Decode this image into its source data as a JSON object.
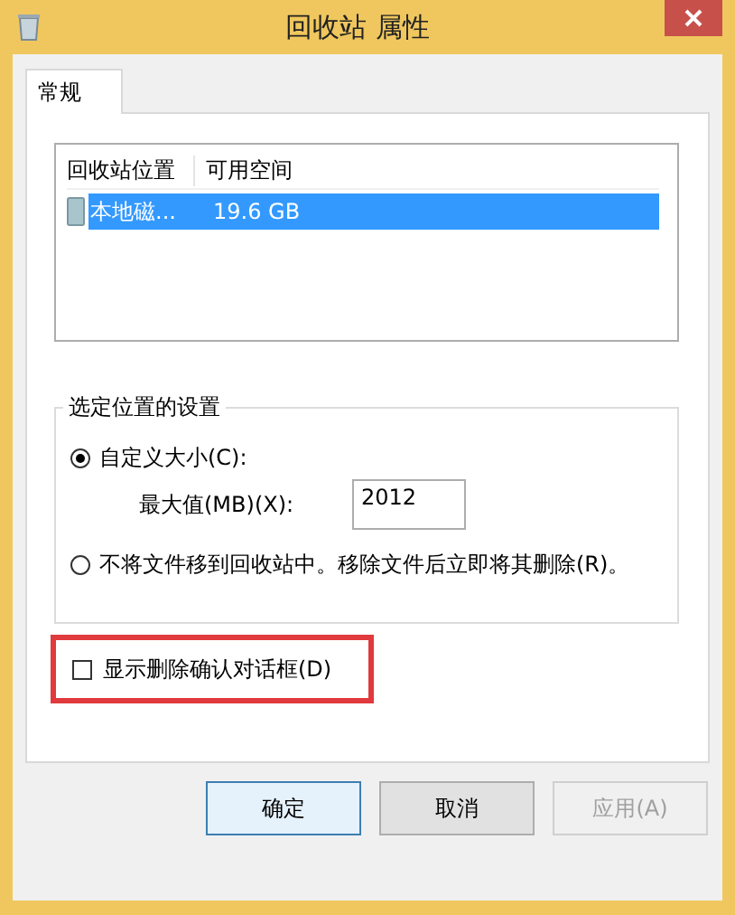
{
  "window": {
    "title": "回收站 属性"
  },
  "tabs": [
    {
      "label": "常规",
      "selected": true
    }
  ],
  "locations": {
    "columns": [
      "回收站位置",
      "可用空间"
    ],
    "rows": [
      {
        "cells": [
          "本地磁...",
          "19.6 GB"
        ],
        "selected": true
      }
    ]
  },
  "settings": {
    "title": "选定位置的设置",
    "options": [
      {
        "label": "自定义大小(C):",
        "selected": true
      },
      {
        "label": "不将文件移到回收站中。移除文件后立即将其删除(R)。",
        "selected": false
      }
    ],
    "max_size": {
      "label": "最大值(MB)(X):",
      "value": "2012"
    }
  },
  "confirm": {
    "label": "显示删除确认对话框(D)",
    "checked": false,
    "highlighted": true
  },
  "buttons": [
    {
      "label": "确定",
      "disabled": false,
      "default": true
    },
    {
      "label": "取消",
      "disabled": false,
      "default": false
    },
    {
      "label": "应用(A)",
      "disabled": true,
      "default": false
    }
  ]
}
